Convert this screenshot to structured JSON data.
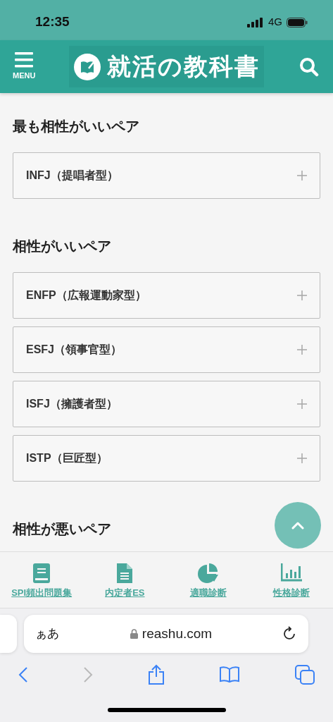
{
  "status_bar": {
    "time": "12:35",
    "network": "4G"
  },
  "header": {
    "menu_label": "MENU",
    "logo_text": "就活の教科書"
  },
  "sections": [
    {
      "heading": "最も相性がいいペア",
      "items": [
        {
          "label": "INFJ（提唱者型）",
          "expanded": false
        }
      ]
    },
    {
      "heading": "相性がいいペア",
      "items": [
        {
          "label": "ENFP（広報運動家型）",
          "expanded": false
        },
        {
          "label": "ESFJ（領事官型）",
          "expanded": false
        },
        {
          "label": "ISFJ（擁護者型）",
          "expanded": false
        },
        {
          "label": "ISTP（巨匠型）",
          "expanded": false
        }
      ]
    },
    {
      "heading": "相性が悪いペア"
    }
  ],
  "bottom_nav": [
    {
      "kind": "book",
      "label": "SPI頻出問題集"
    },
    {
      "kind": "document",
      "label": "内定者ES"
    },
    {
      "kind": "pie",
      "label": "適職診断"
    },
    {
      "kind": "bars",
      "label": "性格診断"
    }
  ],
  "browser": {
    "text_size": "ぁあ",
    "url": "reashu.com",
    "back_disabled": false,
    "forward_disabled": true
  }
}
